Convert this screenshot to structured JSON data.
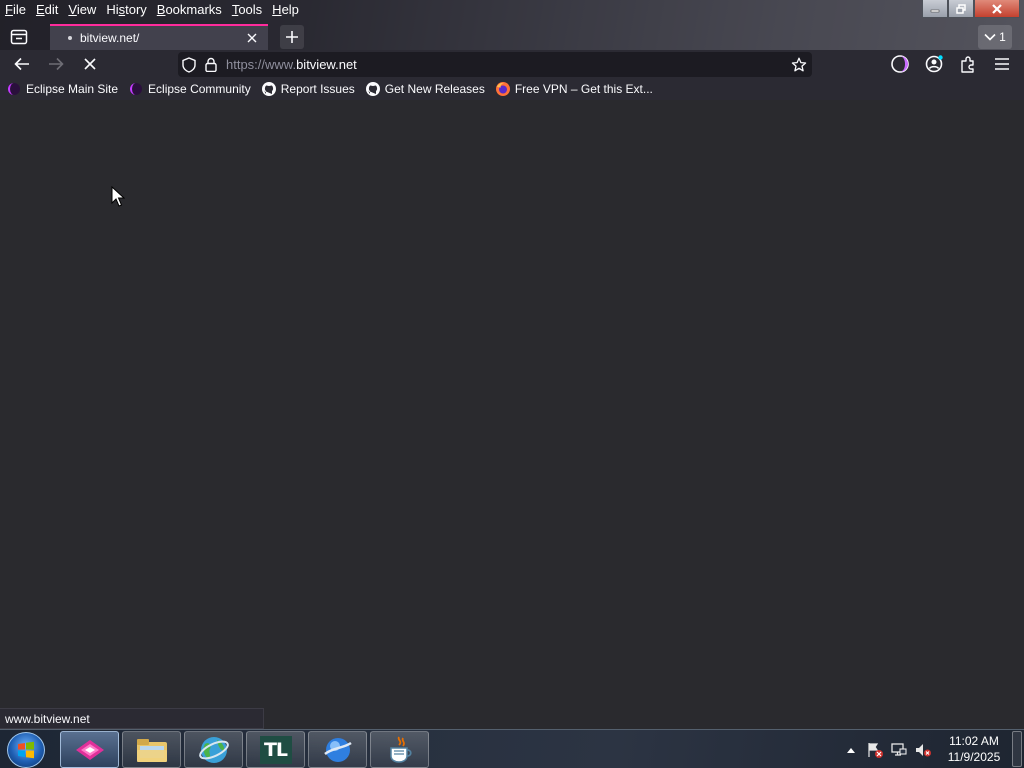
{
  "menubar": {
    "items": [
      {
        "accel": "F",
        "rest": "ile"
      },
      {
        "accel": "E",
        "rest": "dit"
      },
      {
        "accel": "V",
        "rest": "iew"
      },
      {
        "accel": "",
        "pre": "Hi",
        "accel2": "s",
        "rest": "tory"
      },
      {
        "accel": "B",
        "rest": "ookmarks"
      },
      {
        "accel": "T",
        "rest": "ools"
      },
      {
        "accel": "H",
        "rest": "elp"
      }
    ]
  },
  "tabs": {
    "active_title": "bitview.net/",
    "overflow_count": "1"
  },
  "navbar": {
    "url_scheme": "https://www.",
    "url_host": "bitview.net"
  },
  "bookmarks": [
    {
      "label": "Eclipse Main Site",
      "icon": "eclipse-icon"
    },
    {
      "label": "Eclipse Community",
      "icon": "eclipse-icon"
    },
    {
      "label": "Report Issues",
      "icon": "github-icon"
    },
    {
      "label": "Get New Releases",
      "icon": "github-icon"
    },
    {
      "label": "Free VPN – Get this Ext...",
      "icon": "firefox-icon"
    }
  ],
  "status": {
    "link_preview": "www.bitview.net"
  },
  "taskbar": {
    "apps": [
      {
        "name": "browser-app",
        "active": true
      },
      {
        "name": "file-explorer-app",
        "active": false
      },
      {
        "name": "globe-app",
        "active": false
      },
      {
        "name": "tl-app",
        "label": "TL",
        "active": false
      },
      {
        "name": "blue-sphere-app",
        "active": false
      },
      {
        "name": "java-app",
        "active": false
      }
    ],
    "clock_time": "11:02 AM",
    "clock_date": "11/9/2025"
  },
  "colors": {
    "tab_accent": "#ff2b9c",
    "toolbar_bg": "#2b2a33",
    "content_bg": "#2a2a2e",
    "url_bg": "#1c1b22"
  }
}
